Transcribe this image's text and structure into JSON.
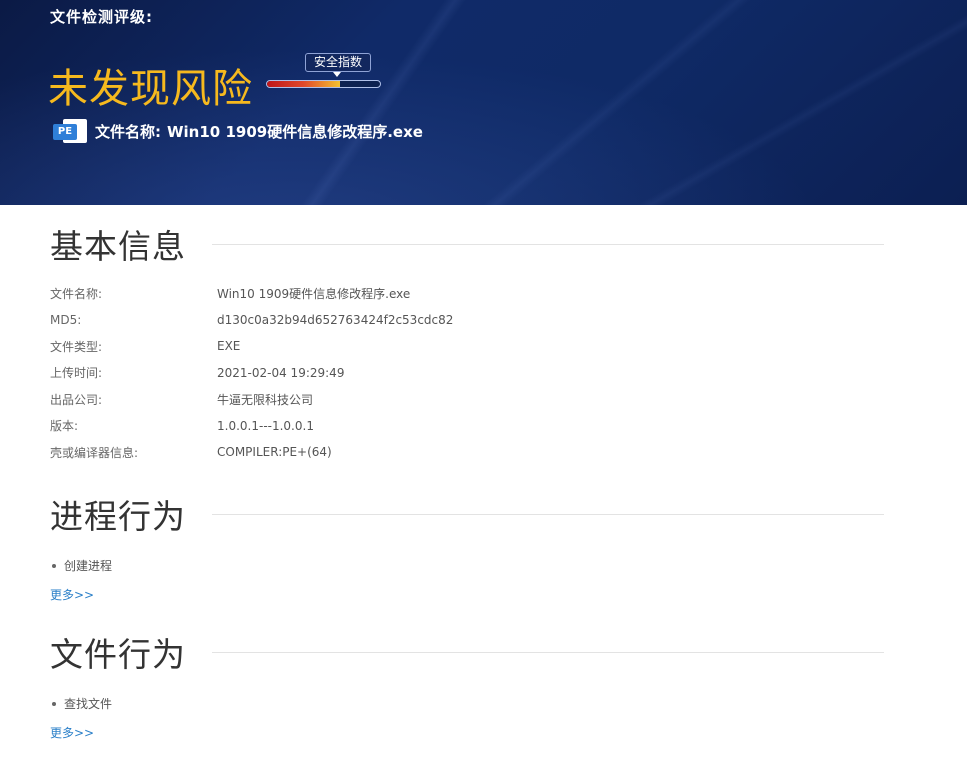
{
  "banner": {
    "label": "文件检测评级:",
    "verdict": "未发现风险",
    "gauge_tag": "安全指数",
    "gauge_level_percent": 65,
    "file_icon": "PE",
    "filename_prefix": "文件名称:",
    "filename": "Win10 1909硬件信息修改程序.exe"
  },
  "sections": {
    "basic_info": {
      "title": "基本信息",
      "rows": [
        {
          "key": "文件名称:",
          "value": "Win10 1909硬件信息修改程序.exe"
        },
        {
          "key": "MD5:",
          "value": "d130c0a32b94d652763424f2c53cdc82"
        },
        {
          "key": "文件类型:",
          "value": "EXE"
        },
        {
          "key": "上传时间:",
          "value": "2021-02-04 19:29:49"
        },
        {
          "key": "出品公司:",
          "value": "牛逼无限科技公司"
        },
        {
          "key": "版本:",
          "value": "1.0.0.1---1.0.0.1"
        },
        {
          "key": "壳或编译器信息:",
          "value": "COMPILER:PE+(64)"
        }
      ]
    },
    "process_behavior": {
      "title": "进程行为",
      "items": [
        "创建进程"
      ],
      "more_label": "更多>>"
    },
    "file_behavior": {
      "title": "文件行为",
      "items": [
        "查找文件"
      ],
      "more_label": "更多>>"
    }
  },
  "colors": {
    "banner_bg": "#0f2a66",
    "verdict": "#f6b91e",
    "link": "#2a7fc8"
  }
}
